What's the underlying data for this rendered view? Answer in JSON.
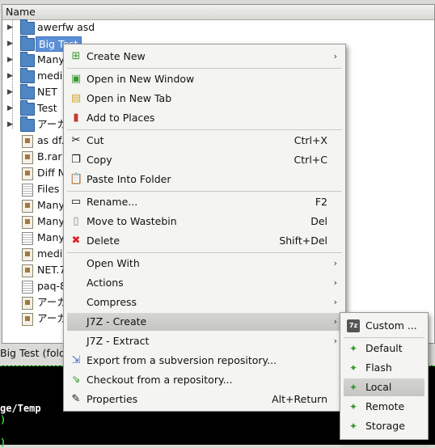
{
  "fileview": {
    "column_header": "Name",
    "rows": [
      {
        "label": "awerfw asd"
      },
      {
        "label": "Big Test"
      },
      {
        "label": "Many"
      },
      {
        "label": "media"
      },
      {
        "label": "NET"
      },
      {
        "label": "Test"
      },
      {
        "label": "アーカ"
      },
      {
        "label": "as df."
      },
      {
        "label": "B.rar"
      },
      {
        "label": "Diff N"
      },
      {
        "label": "Files I"
      },
      {
        "label": "Many"
      },
      {
        "label": "Many"
      },
      {
        "label": "Many."
      },
      {
        "label": "media"
      },
      {
        "label": "NET.7"
      },
      {
        "label": "paq-8"
      },
      {
        "label": "アーカ"
      },
      {
        "label": "アーカ"
      }
    ]
  },
  "statusbar": {
    "text": "Big Test (fold"
  },
  "terminal": {
    "line1": "ge/Temp",
    "line2": ")",
    "line3": ")"
  },
  "context_menu": {
    "items": [
      {
        "label": "Create New",
        "icon": "create-new-icon",
        "submenu": true
      },
      {
        "label": "Open in New Window",
        "icon": "new-window-icon"
      },
      {
        "label": "Open in New Tab",
        "icon": "new-tab-icon"
      },
      {
        "label": "Add to Places",
        "icon": "add-places-icon"
      },
      {
        "label": "Cut",
        "shortcut": "Ctrl+X",
        "icon": "scissors-icon"
      },
      {
        "label": "Copy",
        "shortcut": "Ctrl+C",
        "icon": "copy-icon"
      },
      {
        "label": "Paste Into Folder",
        "icon": "paste-icon"
      },
      {
        "label": "Rename...",
        "shortcut": "F2",
        "icon": "rename-icon"
      },
      {
        "label": "Move to Wastebin",
        "shortcut": "Del",
        "icon": "wastebin-icon"
      },
      {
        "label": "Delete",
        "shortcut": "Shift+Del",
        "icon": "delete-icon"
      },
      {
        "label": "Open With",
        "submenu": true
      },
      {
        "label": "Actions",
        "submenu": true
      },
      {
        "label": "Compress",
        "submenu": true
      },
      {
        "label": "J7Z - Create",
        "submenu": true
      },
      {
        "label": "J7Z - Extract",
        "submenu": true
      },
      {
        "label": "Export from a subversion repository...",
        "icon": "svn-export-icon"
      },
      {
        "label": "Checkout from a repository...",
        "icon": "checkout-icon"
      },
      {
        "label": "Properties",
        "shortcut": "Alt+Return",
        "icon": "properties-icon"
      }
    ]
  },
  "submenu": {
    "custom_icon": "7z",
    "items": [
      {
        "label": "Custom ..."
      },
      {
        "label": "Default"
      },
      {
        "label": "Flash"
      },
      {
        "label": "Local"
      },
      {
        "label": "Remote"
      },
      {
        "label": "Storage"
      }
    ]
  }
}
